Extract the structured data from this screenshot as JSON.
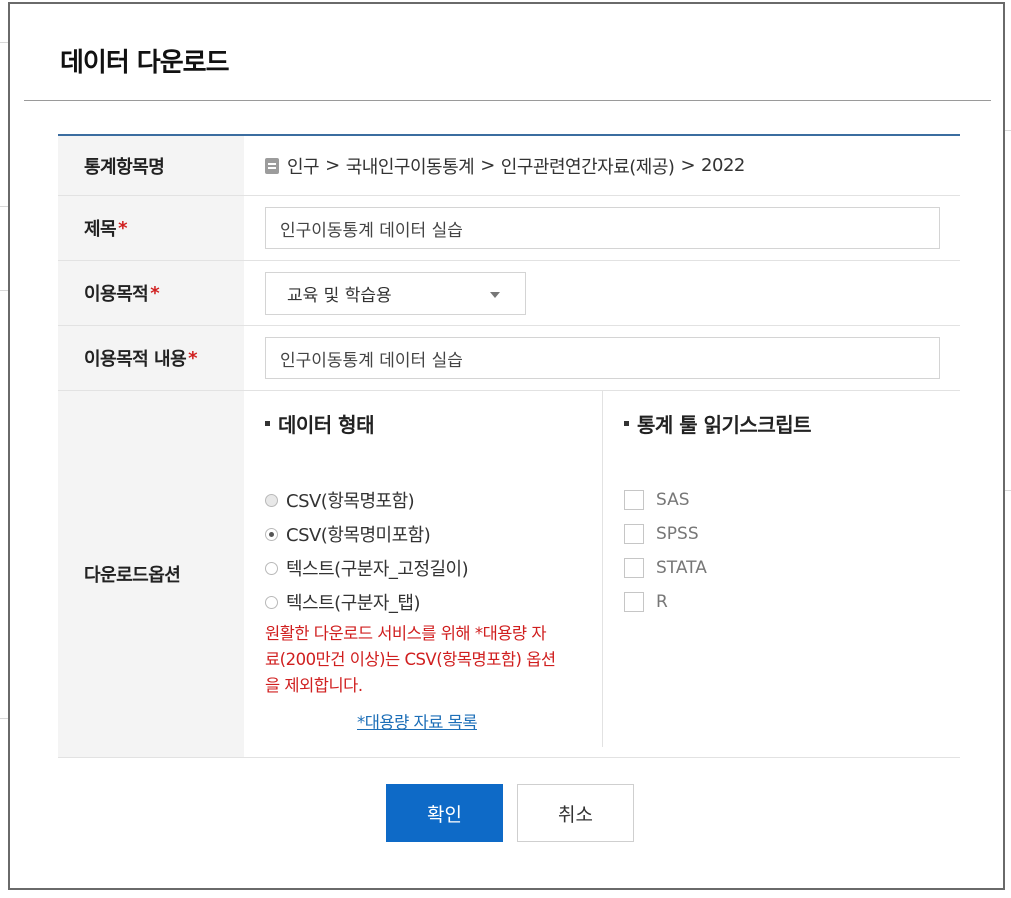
{
  "dialog": {
    "title": "데이터 다운로드"
  },
  "form": {
    "stat_item": {
      "label": "통계항목명",
      "path": [
        "인구",
        "국내인구이동통계",
        "인구관련연간자료(제공)",
        "2022"
      ],
      "separator": ">"
    },
    "title": {
      "label": "제목",
      "required_mark": "*",
      "value": "인구이동통계 데이터 실습"
    },
    "purpose": {
      "label": "이용목적",
      "required_mark": "*",
      "selected": "교육 및 학습용"
    },
    "purpose_detail": {
      "label": "이용목적 내용",
      "required_mark": "*",
      "value": "인구이동통계 데이터 실습"
    },
    "download_options": {
      "label": "다운로드옵션",
      "data_format": {
        "heading": "데이터 형태",
        "options": [
          {
            "label": "CSV(항목명포함)",
            "state": "disabled"
          },
          {
            "label": "CSV(항목명미포함)",
            "state": "checked"
          },
          {
            "label": "텍스트(구분자_고정길이)",
            "state": "unchecked"
          },
          {
            "label": "텍스트(구분자_탭)",
            "state": "unchecked"
          }
        ],
        "notice_lines": [
          "원활한 다운로드 서비스를 위해 *대용량 자",
          "료(200만건 이상)는 CSV(항목명포함) 옵션",
          "을 제외합니다."
        ],
        "link": "*대용량 자료 목록"
      },
      "script": {
        "heading": "통계 툴 읽기스크립트",
        "options": [
          "SAS",
          "SPSS",
          "STATA",
          "R"
        ]
      }
    }
  },
  "buttons": {
    "confirm": "확인",
    "cancel": "취소"
  },
  "colors": {
    "primary": "#0e6ac7",
    "required": "#d01f1f",
    "link": "#1d6fb8",
    "header_rule": "#3b6da0"
  }
}
